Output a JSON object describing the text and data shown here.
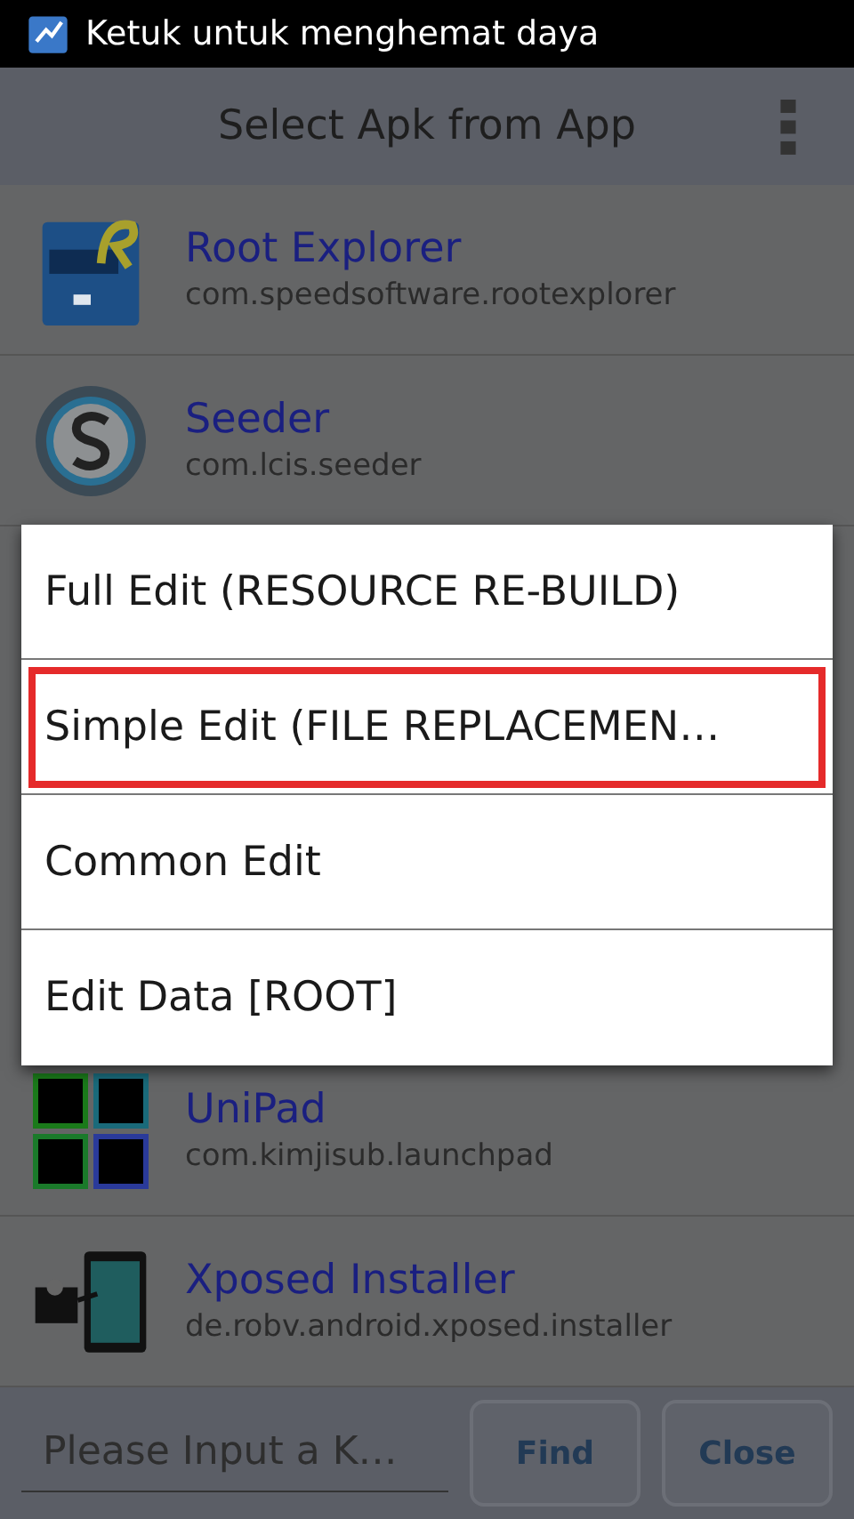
{
  "status_bar": {
    "notification": "Ketuk untuk menghemat daya"
  },
  "title_bar": {
    "title": "Select Apk from App"
  },
  "apps": [
    {
      "name": "Root Explorer",
      "package": "com.speedsoftware.rootexplorer",
      "kind": "cabinet"
    },
    {
      "name": "Seeder",
      "package": "com.lcis.seeder",
      "kind": "seeder"
    },
    {
      "name": "UniPad",
      "package": "com.kimjisub.launchpad",
      "kind": "pads"
    },
    {
      "name": "Xposed Installer",
      "package": "de.robv.android.xposed.installer",
      "kind": "puzzle"
    }
  ],
  "menu": [
    {
      "label": "Full Edit (RESOURCE RE-BUILD)",
      "highlighted": false
    },
    {
      "label": "Simple Edit (FILE REPLACEMEN…",
      "highlighted": true
    },
    {
      "label": "Common Edit",
      "highlighted": false
    },
    {
      "label": "Edit Data [ROOT]",
      "highlighted": false
    }
  ],
  "bottom_bar": {
    "search": {
      "placeholder": "Please Input a K…"
    },
    "buttons": [
      "Find",
      "Close"
    ]
  }
}
